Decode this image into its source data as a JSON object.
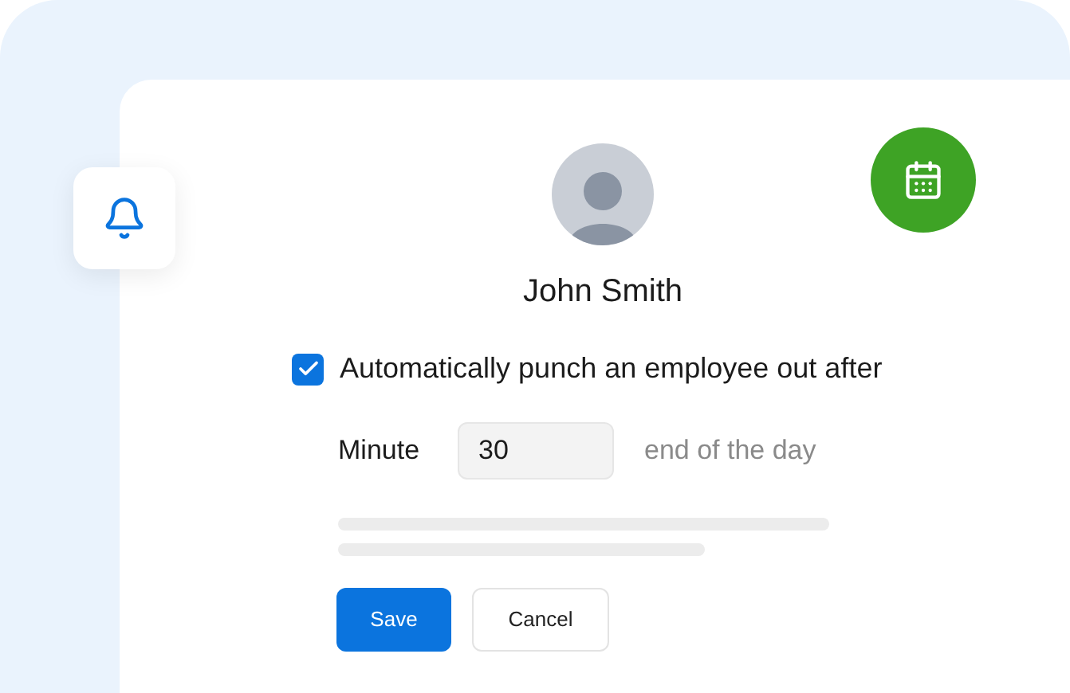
{
  "profile": {
    "name": "John Smith"
  },
  "auto_punch": {
    "label": "Automatically punch an employee out after",
    "checked": true
  },
  "minute_field": {
    "label": "Minute",
    "value": "30",
    "suffix": "end of the day"
  },
  "buttons": [
    {
      "label": "Save",
      "kind": "primary"
    },
    {
      "label": "Cancel",
      "kind": "secondary"
    }
  ]
}
